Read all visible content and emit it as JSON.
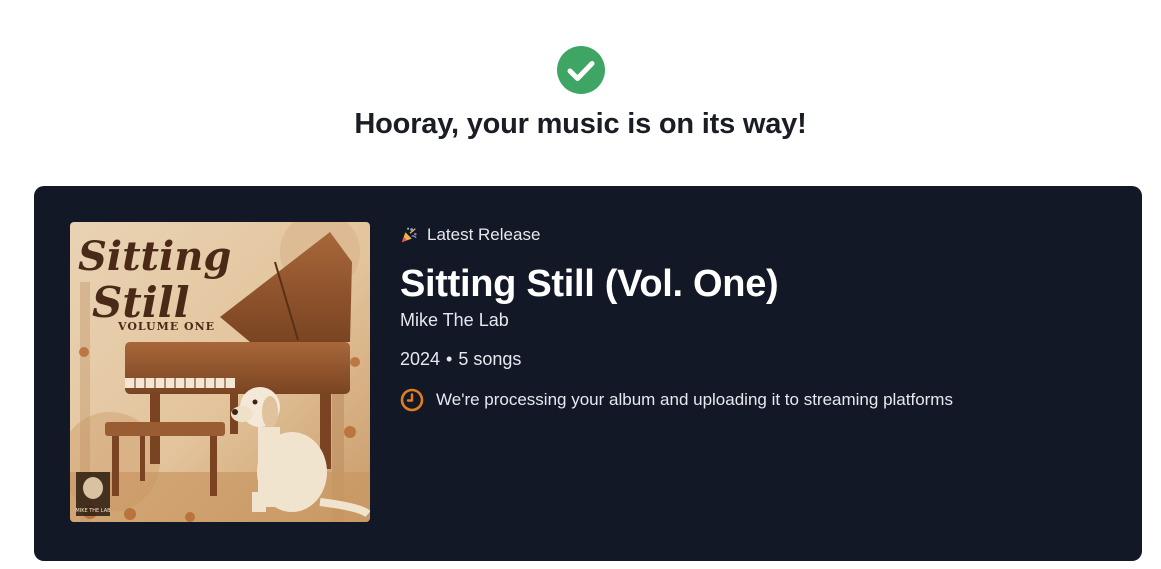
{
  "success": {
    "icon": "check-circle-icon",
    "color": "#3fa565",
    "headline": "Hooray, your music is on its way!"
  },
  "release": {
    "tag_icon": "party-popper-icon",
    "tag_label": "Latest Release",
    "title": "Sitting Still (Vol. One)",
    "artist": "Mike The Lab",
    "year": "2024",
    "separator": "•",
    "song_count": "5 songs",
    "cover_icon": "album-cover-image",
    "cover_text": {
      "title_line1": "Sitting",
      "title_line2": "Still",
      "subtitle": "VOLUME ONE",
      "logo": "MIKE THE LAB"
    }
  },
  "status": {
    "icon": "clock-icon",
    "color": "#e07d20",
    "text": "We're processing your album and uploading it to streaming platforms"
  },
  "colors": {
    "card_background": "#131826",
    "headline_text": "#1a1d24"
  }
}
